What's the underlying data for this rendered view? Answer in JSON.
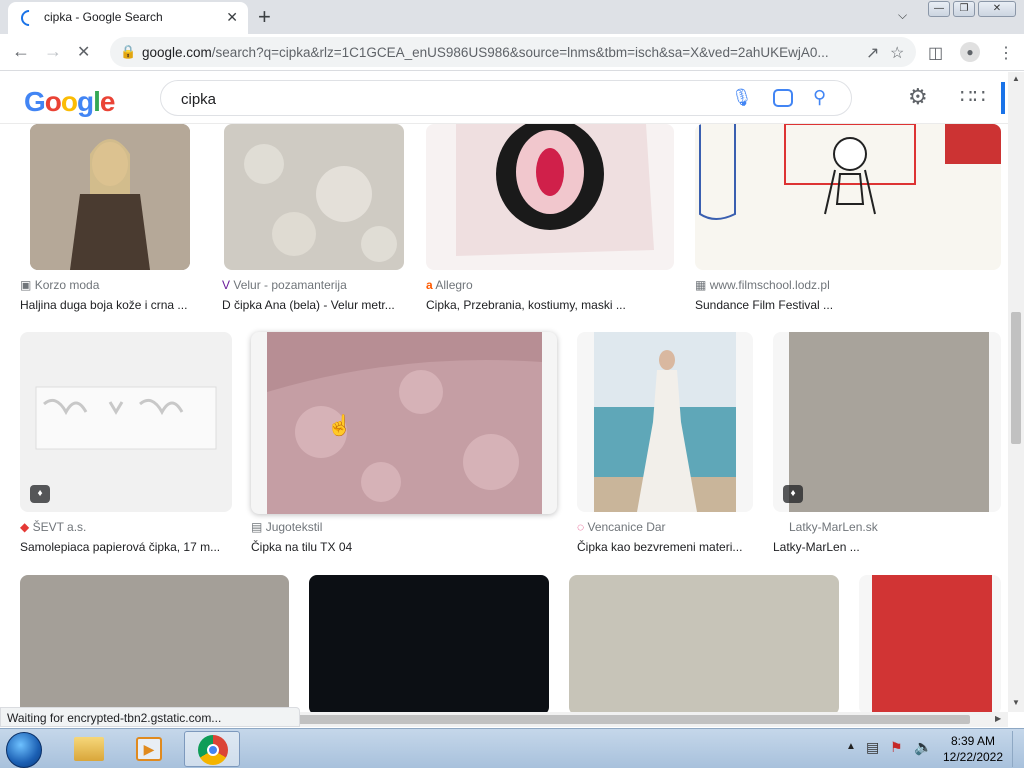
{
  "browser": {
    "tab_title": "cipka - Google Search",
    "tab_close": "✕",
    "new_tab": "+",
    "url_host": "google.com",
    "url_rest": "/search?q=cipka&rlz=1C1GCEA_enUS986US986&source=lnms&tbm=isch&sa=X&ved=2ahUKEwjA0...",
    "status_text": "Waiting for encrypted-tbn2.gstatic.com..."
  },
  "google": {
    "logo_letters": [
      "G",
      "o",
      "o",
      "g",
      "l",
      "e"
    ],
    "logo_colors": [
      "#4285f4",
      "#ea4335",
      "#fbbc05",
      "#4285f4",
      "#34a853",
      "#ea4335"
    ],
    "query": "cipka"
  },
  "results": [
    {
      "source": "Korzo moda",
      "title": "Haljina duga boja kože i crna ...",
      "color": "#8a7a6a",
      "favicon": "▣"
    },
    {
      "source": "Velur - pozamanterija",
      "title": "D čipka Ana (bela) - Velur metr...",
      "color": "#d4d0c8",
      "favicon": "V"
    },
    {
      "source": "Allegro",
      "title": "Cipka, Przebrania, kostiumy, maski ...",
      "color": "#eddcdc",
      "favicon": "a"
    },
    {
      "source": "www.filmschool.lodz.pl",
      "title": "Sundance Film Festival ...",
      "color": "#f8f6f0",
      "favicon": "▦"
    },
    {
      "source": "ŠEVT a.s.",
      "title": "Samolepiaca papierová čipka, 17 m...",
      "color": "#f0f0f0",
      "favicon": "◆"
    },
    {
      "source": "Jugotekstil",
      "title": "Čipka na tilu TX 04",
      "color": "#c7a3a8",
      "favicon": "▤"
    },
    {
      "source": "Vencanice Dar",
      "title": "Čipka kao bezvremeni materi...",
      "color": "#bcd7e0",
      "favicon": "◌"
    },
    {
      "source": "Latky-MarLen.sk",
      "title": "Latky-MarLen ...",
      "color": "#a8a39b",
      "favicon": ""
    },
    {
      "color": "#a49f98"
    },
    {
      "color": "#0c0f14"
    },
    {
      "color": "#c7c4b8"
    },
    {
      "color": "#d13434"
    }
  ],
  "taskbar": {
    "time": "8:39 AM",
    "date": "12/22/2022"
  }
}
